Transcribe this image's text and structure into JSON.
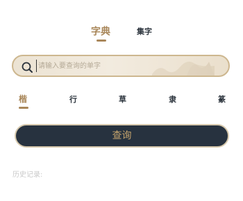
{
  "top_tabs": [
    {
      "label": "字典",
      "active": true
    },
    {
      "label": "集字",
      "active": false
    }
  ],
  "search": {
    "placeholder": "请输入要查询的单字",
    "value": "",
    "icon": "search-icon"
  },
  "style_tabs": [
    {
      "label": "楷",
      "active": true
    },
    {
      "label": "行",
      "active": false
    },
    {
      "label": "草",
      "active": false
    },
    {
      "label": "隶",
      "active": false
    },
    {
      "label": "篆",
      "active": false
    }
  ],
  "query_button": {
    "label": "查询"
  },
  "history": {
    "label": "历史记录:"
  },
  "colors": {
    "accent": "#a9875a",
    "dark": "#27323f",
    "button_text": "#c4a36c",
    "text_dark": "#2b333c",
    "muted": "#c9c9c9",
    "search_bg": "#efe6d7",
    "search_border": "#cdb78f"
  }
}
